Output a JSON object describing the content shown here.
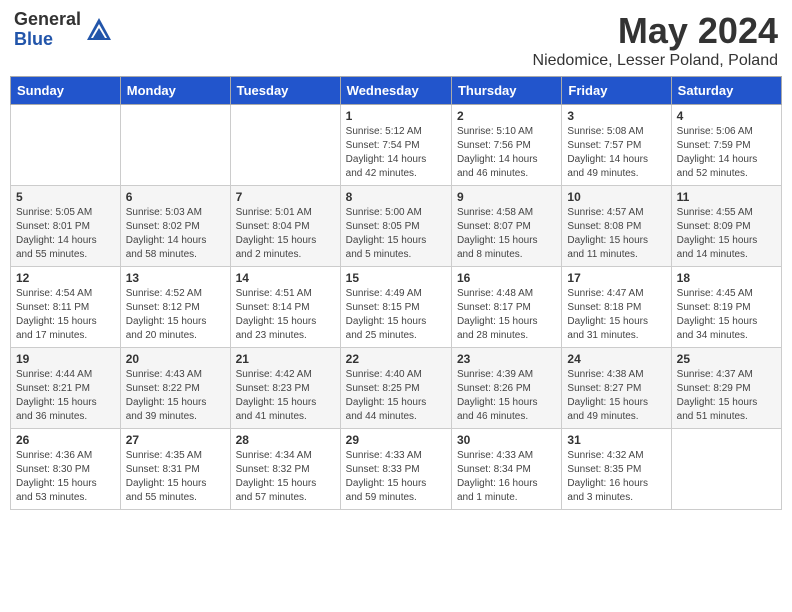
{
  "header": {
    "logo_general": "General",
    "logo_blue": "Blue",
    "month": "May 2024",
    "location": "Niedomice, Lesser Poland, Poland"
  },
  "days_of_week": [
    "Sunday",
    "Monday",
    "Tuesday",
    "Wednesday",
    "Thursday",
    "Friday",
    "Saturday"
  ],
  "weeks": [
    [
      {
        "day": "",
        "info": ""
      },
      {
        "day": "",
        "info": ""
      },
      {
        "day": "",
        "info": ""
      },
      {
        "day": "1",
        "info": "Sunrise: 5:12 AM\nSunset: 7:54 PM\nDaylight: 14 hours\nand 42 minutes."
      },
      {
        "day": "2",
        "info": "Sunrise: 5:10 AM\nSunset: 7:56 PM\nDaylight: 14 hours\nand 46 minutes."
      },
      {
        "day": "3",
        "info": "Sunrise: 5:08 AM\nSunset: 7:57 PM\nDaylight: 14 hours\nand 49 minutes."
      },
      {
        "day": "4",
        "info": "Sunrise: 5:06 AM\nSunset: 7:59 PM\nDaylight: 14 hours\nand 52 minutes."
      }
    ],
    [
      {
        "day": "5",
        "info": "Sunrise: 5:05 AM\nSunset: 8:01 PM\nDaylight: 14 hours\nand 55 minutes."
      },
      {
        "day": "6",
        "info": "Sunrise: 5:03 AM\nSunset: 8:02 PM\nDaylight: 14 hours\nand 58 minutes."
      },
      {
        "day": "7",
        "info": "Sunrise: 5:01 AM\nSunset: 8:04 PM\nDaylight: 15 hours\nand 2 minutes."
      },
      {
        "day": "8",
        "info": "Sunrise: 5:00 AM\nSunset: 8:05 PM\nDaylight: 15 hours\nand 5 minutes."
      },
      {
        "day": "9",
        "info": "Sunrise: 4:58 AM\nSunset: 8:07 PM\nDaylight: 15 hours\nand 8 minutes."
      },
      {
        "day": "10",
        "info": "Sunrise: 4:57 AM\nSunset: 8:08 PM\nDaylight: 15 hours\nand 11 minutes."
      },
      {
        "day": "11",
        "info": "Sunrise: 4:55 AM\nSunset: 8:09 PM\nDaylight: 15 hours\nand 14 minutes."
      }
    ],
    [
      {
        "day": "12",
        "info": "Sunrise: 4:54 AM\nSunset: 8:11 PM\nDaylight: 15 hours\nand 17 minutes."
      },
      {
        "day": "13",
        "info": "Sunrise: 4:52 AM\nSunset: 8:12 PM\nDaylight: 15 hours\nand 20 minutes."
      },
      {
        "day": "14",
        "info": "Sunrise: 4:51 AM\nSunset: 8:14 PM\nDaylight: 15 hours\nand 23 minutes."
      },
      {
        "day": "15",
        "info": "Sunrise: 4:49 AM\nSunset: 8:15 PM\nDaylight: 15 hours\nand 25 minutes."
      },
      {
        "day": "16",
        "info": "Sunrise: 4:48 AM\nSunset: 8:17 PM\nDaylight: 15 hours\nand 28 minutes."
      },
      {
        "day": "17",
        "info": "Sunrise: 4:47 AM\nSunset: 8:18 PM\nDaylight: 15 hours\nand 31 minutes."
      },
      {
        "day": "18",
        "info": "Sunrise: 4:45 AM\nSunset: 8:19 PM\nDaylight: 15 hours\nand 34 minutes."
      }
    ],
    [
      {
        "day": "19",
        "info": "Sunrise: 4:44 AM\nSunset: 8:21 PM\nDaylight: 15 hours\nand 36 minutes."
      },
      {
        "day": "20",
        "info": "Sunrise: 4:43 AM\nSunset: 8:22 PM\nDaylight: 15 hours\nand 39 minutes."
      },
      {
        "day": "21",
        "info": "Sunrise: 4:42 AM\nSunset: 8:23 PM\nDaylight: 15 hours\nand 41 minutes."
      },
      {
        "day": "22",
        "info": "Sunrise: 4:40 AM\nSunset: 8:25 PM\nDaylight: 15 hours\nand 44 minutes."
      },
      {
        "day": "23",
        "info": "Sunrise: 4:39 AM\nSunset: 8:26 PM\nDaylight: 15 hours\nand 46 minutes."
      },
      {
        "day": "24",
        "info": "Sunrise: 4:38 AM\nSunset: 8:27 PM\nDaylight: 15 hours\nand 49 minutes."
      },
      {
        "day": "25",
        "info": "Sunrise: 4:37 AM\nSunset: 8:29 PM\nDaylight: 15 hours\nand 51 minutes."
      }
    ],
    [
      {
        "day": "26",
        "info": "Sunrise: 4:36 AM\nSunset: 8:30 PM\nDaylight: 15 hours\nand 53 minutes."
      },
      {
        "day": "27",
        "info": "Sunrise: 4:35 AM\nSunset: 8:31 PM\nDaylight: 15 hours\nand 55 minutes."
      },
      {
        "day": "28",
        "info": "Sunrise: 4:34 AM\nSunset: 8:32 PM\nDaylight: 15 hours\nand 57 minutes."
      },
      {
        "day": "29",
        "info": "Sunrise: 4:33 AM\nSunset: 8:33 PM\nDaylight: 15 hours\nand 59 minutes."
      },
      {
        "day": "30",
        "info": "Sunrise: 4:33 AM\nSunset: 8:34 PM\nDaylight: 16 hours\nand 1 minute."
      },
      {
        "day": "31",
        "info": "Sunrise: 4:32 AM\nSunset: 8:35 PM\nDaylight: 16 hours\nand 3 minutes."
      },
      {
        "day": "",
        "info": ""
      }
    ]
  ]
}
